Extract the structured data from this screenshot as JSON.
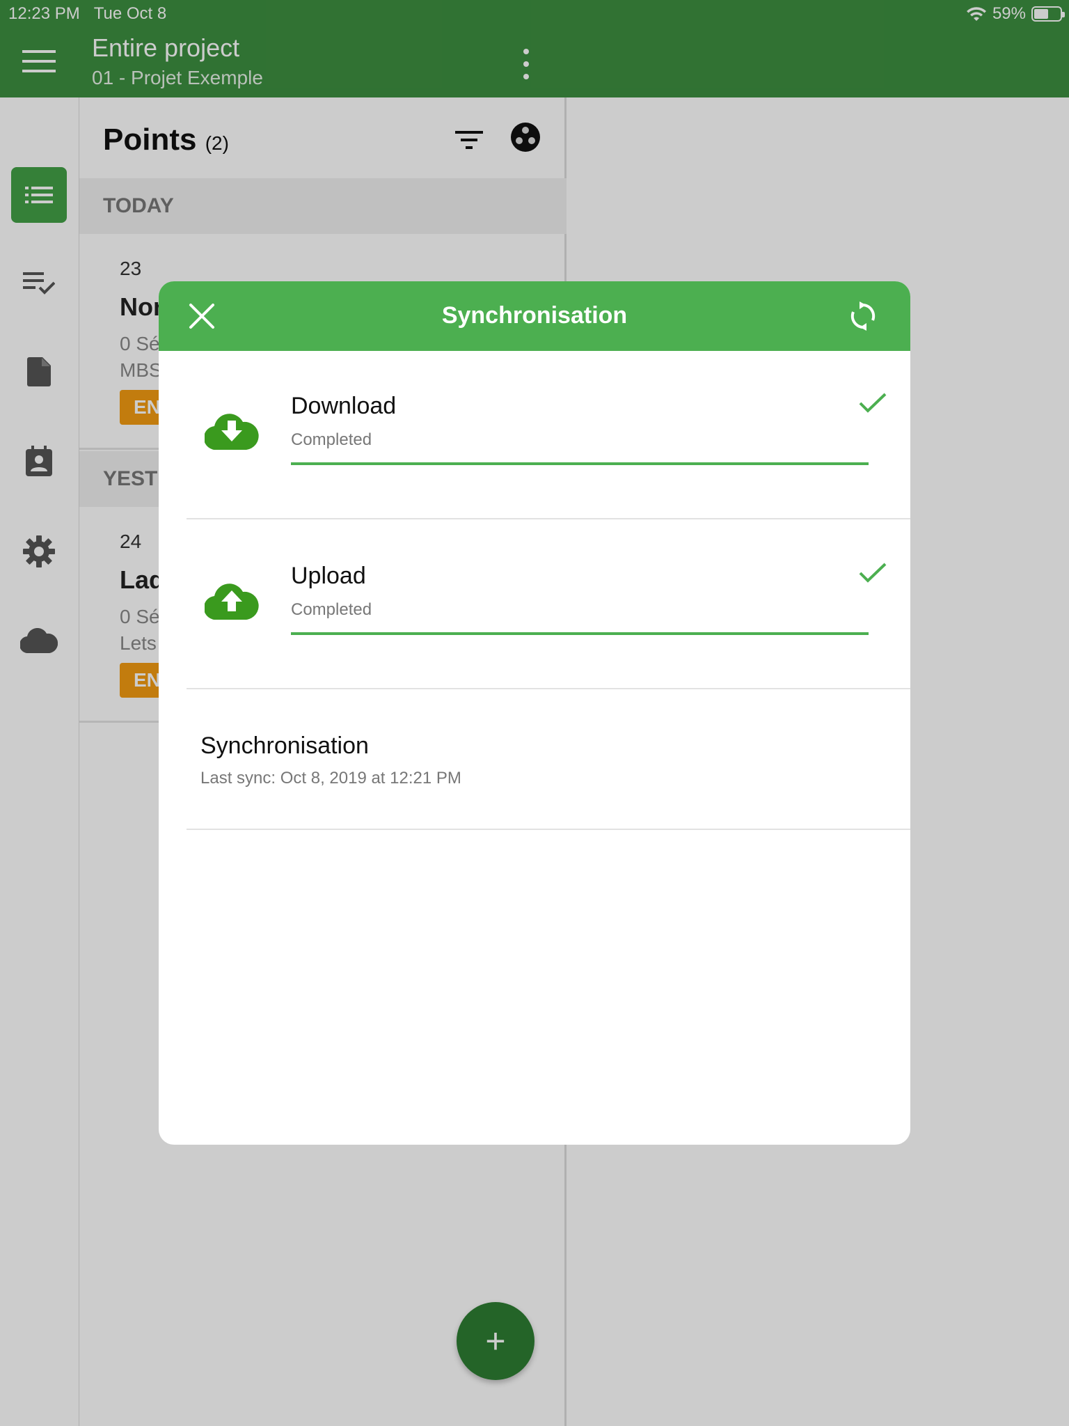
{
  "status_bar": {
    "time": "12:23 PM",
    "date": "Tue Oct 8",
    "battery": "59%",
    "battery_level": 0.59
  },
  "app_bar": {
    "title": "Entire project",
    "subtitle": "01 - Projet Exemple",
    "menu_icon": "hamburger-icon",
    "overflow_icon": "more-vert-icon"
  },
  "rail": {
    "items": [
      {
        "icon": "list-icon",
        "active": true
      },
      {
        "icon": "checklist-icon",
        "active": false
      },
      {
        "icon": "document-icon",
        "active": false
      },
      {
        "icon": "contact-calendar-icon",
        "active": false
      },
      {
        "icon": "gear-icon",
        "active": false
      },
      {
        "icon": "cloud-icon",
        "active": false
      }
    ]
  },
  "points": {
    "title": "Points",
    "count": "(2)",
    "sections": [
      {
        "label": "TODAY"
      },
      {
        "label": "YESTERDAY"
      }
    ],
    "cards": [
      {
        "number": "23",
        "title": "Nor",
        "line1": "0 Sé",
        "line2": "MBS",
        "badge": "EN"
      },
      {
        "number": "24",
        "title": "Lad",
        "line1": "0 Sé",
        "line2": "Lets",
        "badge": "EN"
      }
    ],
    "fab_label": "+"
  },
  "dialog": {
    "title": "Synchronisation",
    "download": {
      "label": "Download",
      "status": "Completed",
      "progress": 1.0,
      "icon": "cloud-download-icon"
    },
    "upload": {
      "label": "Upload",
      "status": "Completed",
      "progress": 1.0,
      "icon": "cloud-upload-icon"
    },
    "last_sync": {
      "title": "Synchronisation",
      "subtitle": "Last sync: Oct 8, 2019 at 12:21 PM"
    }
  },
  "colors": {
    "app_bar": "#3d8f40",
    "dialog_header": "#4caf50",
    "accent_green": "#4caf50",
    "icon_green": "#3a9a1e",
    "badge_orange": "#f39c12",
    "fab": "#2e7d32"
  }
}
